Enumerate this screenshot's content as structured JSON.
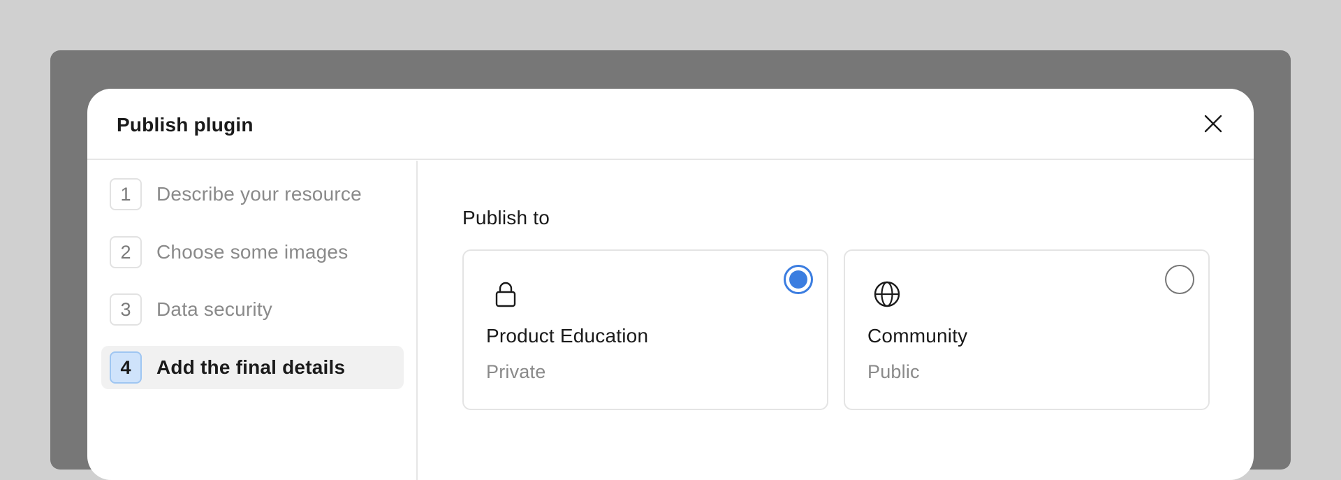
{
  "modal": {
    "title": "Publish plugin"
  },
  "steps": [
    {
      "number": "1",
      "label": "Describe your resource",
      "active": false
    },
    {
      "number": "2",
      "label": "Choose some images",
      "active": false
    },
    {
      "number": "3",
      "label": "Data security",
      "active": false
    },
    {
      "number": "4",
      "label": "Add the final details",
      "active": true
    }
  ],
  "publish": {
    "label": "Publish to",
    "options": [
      {
        "title": "Product Education",
        "subtitle": "Private",
        "icon": "lock-icon",
        "selected": true
      },
      {
        "title": "Community",
        "subtitle": "Public",
        "icon": "globe-icon",
        "selected": false
      }
    ]
  },
  "colors": {
    "accent": "#3b7de0",
    "active_step_bg": "#cfe3fb",
    "backdrop": "#777777"
  }
}
